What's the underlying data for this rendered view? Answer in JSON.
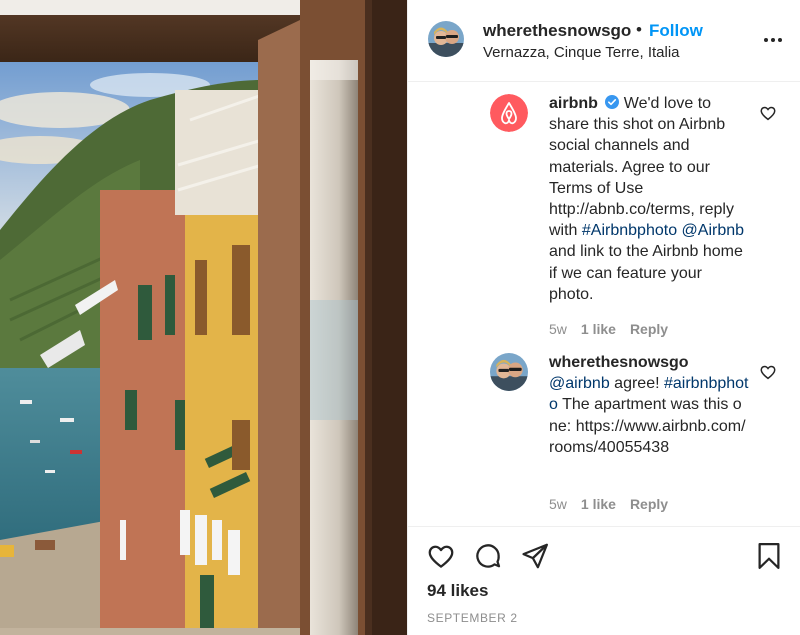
{
  "post": {
    "username": "wherethesnowsgo",
    "separator": "•",
    "follow_label": "Follow",
    "location": "Vernazza, Cinque Terre, Italia"
  },
  "comments": [
    {
      "author": "airbnb",
      "verified": true,
      "text_before": " We'd love to share this shot on Airbnb social channels and materials. Agree to our Terms of Use http://abnb.co/terms, reply with ",
      "hashtag": "#Airbnbphoto",
      "mention": "@Airbnb",
      "text_after": " and link to the Airbnb home if we can feature your photo.",
      "age": "5w",
      "likes": "1 like",
      "reply_label": "Reply",
      "avatar_color": "#ff5a5f"
    },
    {
      "author": "wherethesnowsgo",
      "mention": "@airbnb",
      "text_mid": " agree! ",
      "hashtag": "#airbnbphoto",
      "text_after": " The apartment was this one: https://www.airbnb.com/rooms/40055438",
      "age": "5w",
      "likes": "1 like",
      "reply_label": "Reply"
    }
  ],
  "actions": {
    "icons": [
      "heart-icon",
      "comment-icon",
      "share-icon",
      "bookmark-icon"
    ],
    "likes": "94 likes",
    "date": "SEPTEMBER 2"
  },
  "colors": {
    "follow": "#0095f6",
    "link": "#00376b",
    "muted": "#8e8e8e",
    "verified": "#3897f0"
  }
}
